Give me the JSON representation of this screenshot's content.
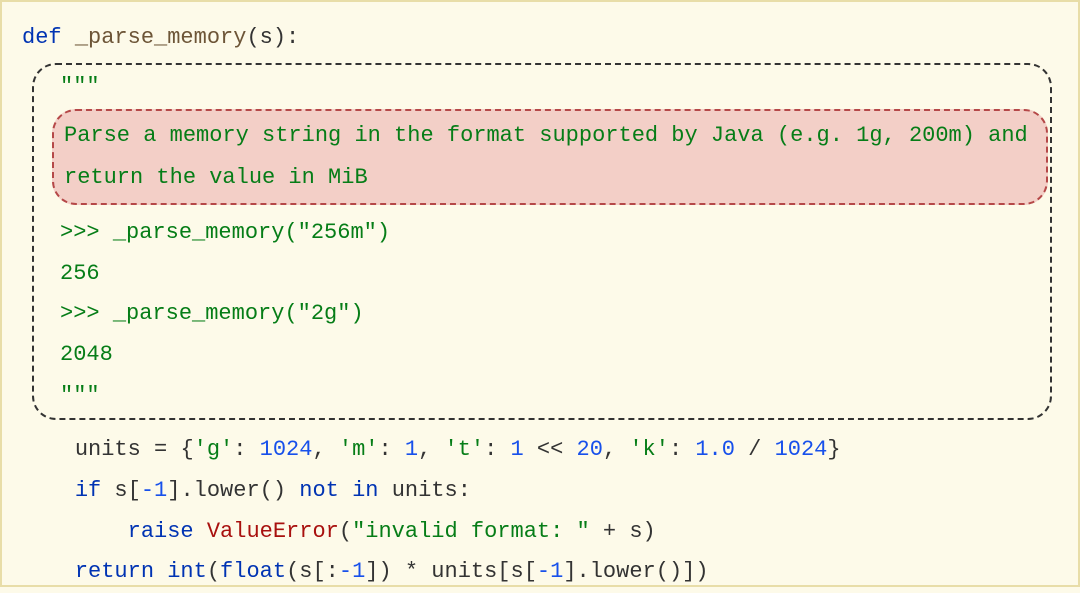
{
  "code": {
    "def": "def",
    "funcname": "_parse_memory",
    "param": "s",
    "docstring_open": "\"\"\"",
    "docstring_line1": "Parse a memory string in the format supported by Java (e.g. 1g, 200m) and",
    "docstring_line2": "return the value in MiB",
    "doctest_l1_prefix": ">>> ",
    "doctest_l1_call": "_parse_memory",
    "doctest_l1_arg": "\"256m\"",
    "doctest_l1_result": "256",
    "doctest_l2_call": "_parse_memory",
    "doctest_l2_arg": "\"2g\"",
    "doctest_l2_result": "2048",
    "docstring_close": "\"\"\"",
    "units_var": "units",
    "eq": " = ",
    "brace_open": "{",
    "g_key": "'g'",
    "colon": ": ",
    "g_val": "1024",
    "comma": ", ",
    "m_key": "'m'",
    "m_val": "1",
    "t_key": "'t'",
    "t_val_a": "1",
    "shift": " << ",
    "t_val_b": "20",
    "k_key": "'k'",
    "k_val_a": "1.0",
    "div": " / ",
    "k_val_b": "1024",
    "brace_close": "}",
    "if": "if",
    "s_idx": "s[",
    "neg1": "-1",
    "rb": "]",
    "dot_lower": ".lower()",
    "not_in": " not in ",
    "raise": "raise",
    "valError": "ValueError",
    "invalid_str": "\"invalid format: \"",
    "plus": " + ",
    "return": "return",
    "int": "int",
    "float": "float",
    "slice_open": "s[:",
    "mul": " * ",
    "units_ref": "units[s[",
    "close1": "].lower()])"
  }
}
